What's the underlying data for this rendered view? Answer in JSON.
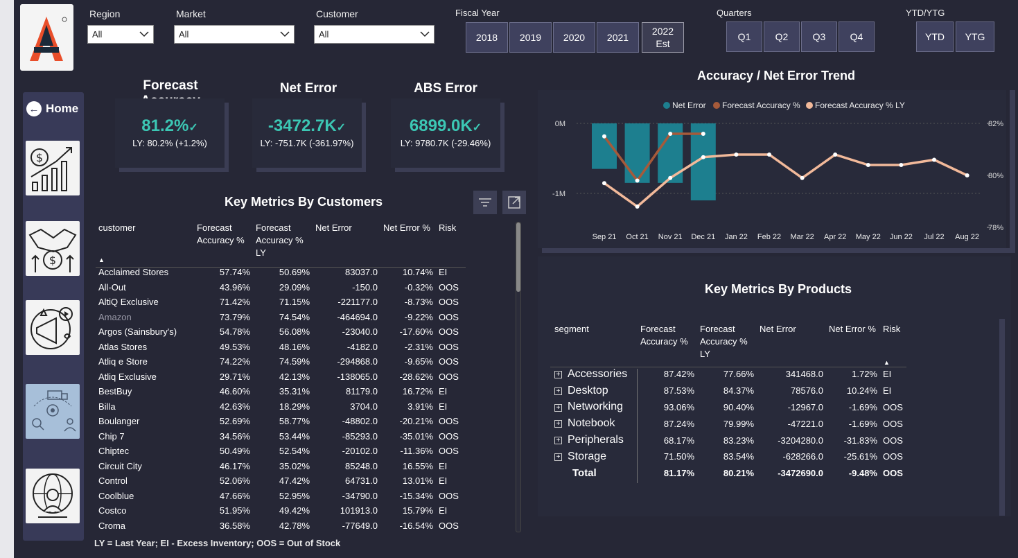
{
  "filters": {
    "region": {
      "label": "Region",
      "value": "All"
    },
    "market": {
      "label": "Market",
      "value": "All"
    },
    "customer": {
      "label": "Customer",
      "value": "All"
    },
    "fiscal_year": {
      "label": "Fiscal Year",
      "options": [
        "2018",
        "2019",
        "2020",
        "2021",
        "2022\nEst"
      ]
    },
    "quarters": {
      "label": "Quarters",
      "options": [
        "Q1",
        "Q2",
        "Q3",
        "Q4"
      ]
    },
    "ytd": {
      "label": "YTD/YTG",
      "options": [
        "YTD",
        "YTG"
      ]
    }
  },
  "sidebar": {
    "home_label": "Home",
    "icons": [
      "finance-growth-icon",
      "handshake-money-icon",
      "marketing-megaphone-icon",
      "supply-chain-icon",
      "global-support-icon"
    ]
  },
  "kpis": [
    {
      "title": "Forecast Accuracy",
      "value": "81.2%",
      "ly": "LY: 80.2% (+1.2%)"
    },
    {
      "title": "Net Error",
      "value": "-3472.7K",
      "ly": "LY: -751.7K (-361.97%)"
    },
    {
      "title": "ABS Error",
      "value": "6899.0K",
      "ly": "LY: 9780.7K (-29.46%)"
    }
  ],
  "customers": {
    "title": "Key Metrics By Customers",
    "headers": [
      "customer",
      "Forecast Accuracy %",
      "Forecast Accuracy % LY",
      "Net Error",
      "Net Error %",
      "Risk"
    ],
    "rows": [
      [
        "Acclaimed Stores",
        "57.74%",
        "50.69%",
        "83037.0",
        "10.74%",
        "EI"
      ],
      [
        "All-Out",
        "43.96%",
        "29.09%",
        "-150.0",
        "-0.32%",
        "OOS"
      ],
      [
        "AltiQ Exclusive",
        "71.42%",
        "71.15%",
        "-221177.0",
        "-8.73%",
        "OOS"
      ],
      [
        "Amazon",
        "73.79%",
        "74.54%",
        "-464694.0",
        "-9.22%",
        "OOS"
      ],
      [
        "Argos (Sainsbury's)",
        "54.78%",
        "56.08%",
        "-23040.0",
        "-17.60%",
        "OOS"
      ],
      [
        "Atlas Stores",
        "49.53%",
        "48.16%",
        "-4182.0",
        "-2.31%",
        "OOS"
      ],
      [
        "Atliq e Store",
        "74.22%",
        "74.59%",
        "-294868.0",
        "-9.65%",
        "OOS"
      ],
      [
        "Atliq Exclusive",
        "29.71%",
        "42.13%",
        "-138065.0",
        "-28.62%",
        "OOS"
      ],
      [
        "BestBuy",
        "46.60%",
        "35.31%",
        "81179.0",
        "16.72%",
        "EI"
      ],
      [
        "Billa",
        "42.63%",
        "18.29%",
        "3704.0",
        "3.91%",
        "EI"
      ],
      [
        "Boulanger",
        "52.69%",
        "58.77%",
        "-48802.0",
        "-20.21%",
        "OOS"
      ],
      [
        "Chip 7",
        "34.56%",
        "53.44%",
        "-85293.0",
        "-35.01%",
        "OOS"
      ],
      [
        "Chiptec",
        "50.49%",
        "52.54%",
        "-20102.0",
        "-11.36%",
        "OOS"
      ],
      [
        "Circuit City",
        "46.17%",
        "35.02%",
        "85248.0",
        "16.55%",
        "EI"
      ],
      [
        "Control",
        "52.06%",
        "47.42%",
        "64731.0",
        "13.01%",
        "EI"
      ],
      [
        "Coolblue",
        "47.66%",
        "52.95%",
        "-34790.0",
        "-15.34%",
        "OOS"
      ],
      [
        "Costco",
        "51.95%",
        "49.42%",
        "101913.0",
        "15.79%",
        "EI"
      ],
      [
        "Croma",
        "36.58%",
        "42.78%",
        "-77649.0",
        "-16.54%",
        "OOS"
      ]
    ]
  },
  "footer_note": "LY = Last Year; EI - Excess Inventory; OOS = Out of Stock",
  "trend": {
    "title": "Accuracy / Net Error Trend",
    "legend": [
      "Net Error",
      "Forecast Accuracy %",
      "Forecast Accuracy % LY"
    ],
    "left_ticks": [
      "0M",
      "-1M"
    ],
    "right_ticks": [
      "82%",
      "80%",
      "78%"
    ]
  },
  "chart_data": {
    "type": "bar",
    "title": "Accuracy / Net Error Trend",
    "categories": [
      "Sep 21",
      "Oct 21",
      "Nov 21",
      "Dec 21",
      "Jan 22",
      "Feb 22",
      "Mar 22",
      "Apr 22",
      "May 22",
      "Jun 22",
      "Jul 22",
      "Aug 22"
    ],
    "series": [
      {
        "name": "Net Error",
        "type": "bar",
        "axis": "left",
        "color": "#1d7f8f",
        "values": [
          -0.65,
          -0.85,
          -0.85,
          -1.1,
          null,
          null,
          null,
          null,
          null,
          null,
          null,
          null
        ]
      },
      {
        "name": "Forecast Accuracy %",
        "type": "line",
        "axis": "right",
        "color": "#a65a3a",
        "values": [
          81.5,
          79.8,
          81.6,
          81.6,
          null,
          null,
          null,
          null,
          null,
          null,
          null,
          null
        ]
      },
      {
        "name": "Forecast Accuracy % LY",
        "type": "line",
        "axis": "right",
        "color": "#f2b99a",
        "values": [
          79.7,
          78.8,
          79.9,
          80.7,
          80.8,
          80.8,
          79.9,
          80.8,
          80.4,
          80.4,
          80.6,
          80.0
        ]
      }
    ],
    "ylim_left": [
      -1.5,
      0
    ],
    "ylim_right": [
      78,
      82
    ],
    "legend": "top"
  },
  "products": {
    "title": "Key Metrics By Products",
    "headers": [
      "segment",
      "Forecast Accuracy %",
      "Forecast Accuracy % LY",
      "Net Error",
      "Net Error %",
      "Risk"
    ],
    "rows": [
      [
        "Accessories",
        "87.42%",
        "77.66%",
        "341468.0",
        "1.72%",
        "EI"
      ],
      [
        "Desktop",
        "87.53%",
        "84.37%",
        "78576.0",
        "10.24%",
        "EI"
      ],
      [
        "Networking",
        "93.06%",
        "90.40%",
        "-12967.0",
        "-1.69%",
        "OOS"
      ],
      [
        "Notebook",
        "87.24%",
        "79.99%",
        "-47221.0",
        "-1.69%",
        "OOS"
      ],
      [
        "Peripherals",
        "68.17%",
        "83.23%",
        "-3204280.0",
        "-31.83%",
        "OOS"
      ],
      [
        "Storage",
        "71.50%",
        "83.54%",
        "-628266.0",
        "-25.61%",
        "OOS"
      ]
    ],
    "total": [
      "Total",
      "81.17%",
      "80.21%",
      "-3472690.0",
      "-9.48%",
      "OOS"
    ]
  }
}
